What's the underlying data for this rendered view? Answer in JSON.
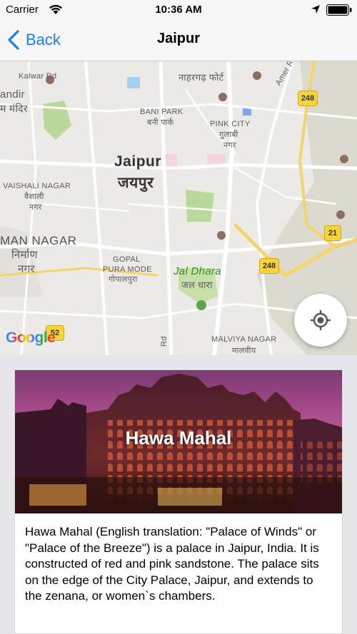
{
  "status_bar": {
    "carrier": "Carrier",
    "time": "10:36 AM"
  },
  "nav": {
    "back_label": "Back",
    "title": "Jaipur"
  },
  "map": {
    "labels": {
      "kalwar_rd": "Kalwar Rd",
      "nahargarh": "नाहरगढ़ फोर्ट",
      "andir": "andir",
      "mandir_hi": "म मंदिर",
      "bani_park": "BANI PARK",
      "bani_park_hi": "बनी पार्क",
      "pink_city": "PINK CITY",
      "pink_city_hi": "गुलाबी",
      "pink_city_hi2": "नगर",
      "jaipur": "Jaipur",
      "jaipur_hi": "जयपुर",
      "vaishali": "VAISHALI NAGAR",
      "vaishali_hi": "वैशाली",
      "vaishali_hi2": "नगर",
      "man_nagar": "MAN NAGAR",
      "man_nagar_hi": "निर्माण",
      "man_nagar_hi2": "नगर",
      "gopal_pura": "GOPAL",
      "gopal_pura2": "PURA MODE",
      "gopal_pura_hi": "गोपालपुरा",
      "jal_dhara": "Jal Dhara",
      "jal_dhara_hi": "जल धारा",
      "malviya": "MALVIYA NAGAR",
      "malviya_hi": "मालवीय",
      "amer_rd": "Amer R",
      "rd": "Rd"
    },
    "shields": {
      "s248a": "248",
      "s248b": "248",
      "s21": "21",
      "s52": "52"
    },
    "google_logo": "Google"
  },
  "card": {
    "title": "Hawa Mahal",
    "description": "Hawa Mahal (English translation: \"Palace of Winds\" or \"Palace of the Breeze\") is a palace in Jaipur, India. It is constructed of red and pink sandstone. The palace sits on the edge of the City Palace, Jaipur, and extends to the zenana, or women`s chambers."
  }
}
